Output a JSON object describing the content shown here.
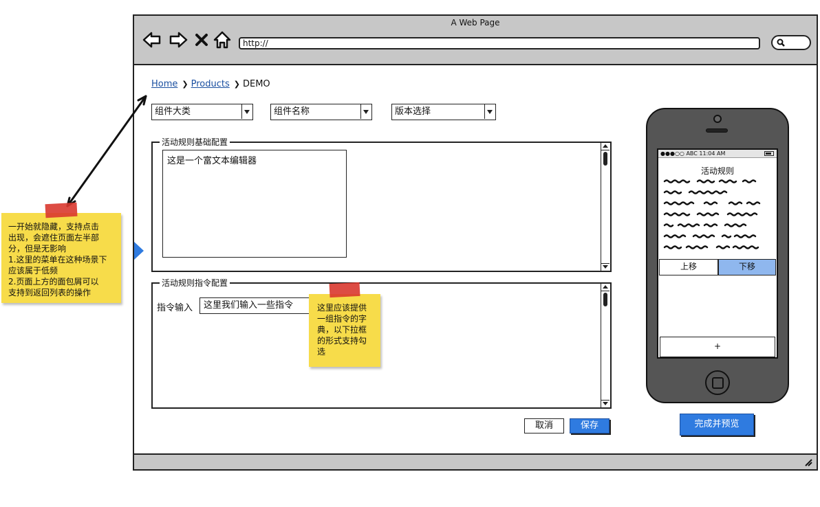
{
  "window": {
    "title": "A Web Page",
    "url": "http://"
  },
  "breadcrumb": {
    "home": "Home",
    "products": "Products",
    "current": "DEMO"
  },
  "filters": {
    "category": "组件大类",
    "component": "组件名称",
    "version": "版本选择"
  },
  "basic_config": {
    "title": "活动规则基础配置",
    "editor_text": "这是一个富文本编辑器"
  },
  "command_config": {
    "title": "活动规则指令配置",
    "label": "指令输入",
    "input_value": "这里我们输入一些指令"
  },
  "actions": {
    "cancel": "取消",
    "save": "保存",
    "preview": "完成并预览"
  },
  "phone": {
    "status": "●●●○○ ABC  11:04 AM",
    "title": "活动规则",
    "move_up": "上移",
    "move_down": "下移",
    "add": "+"
  },
  "notes": {
    "left_lines": [
      "一开始就隐藏，支持点击",
      "出现，会遮住页面左半部",
      "分，但是无影响",
      "1.这里的菜单在这种场景下",
      "应该属于低频",
      "2.页面上方的面包屑可以",
      "支持到返回列表的操作"
    ],
    "middle_lines": [
      "这里应该提供",
      "一组指令的字",
      "典，以下拉框",
      "的形式支持勾",
      "选"
    ]
  },
  "colors": {
    "accent": "#2f7be0",
    "chrome": "#c7c7c7",
    "sticky": "#f7dc4a",
    "tape": "#d9382f"
  }
}
